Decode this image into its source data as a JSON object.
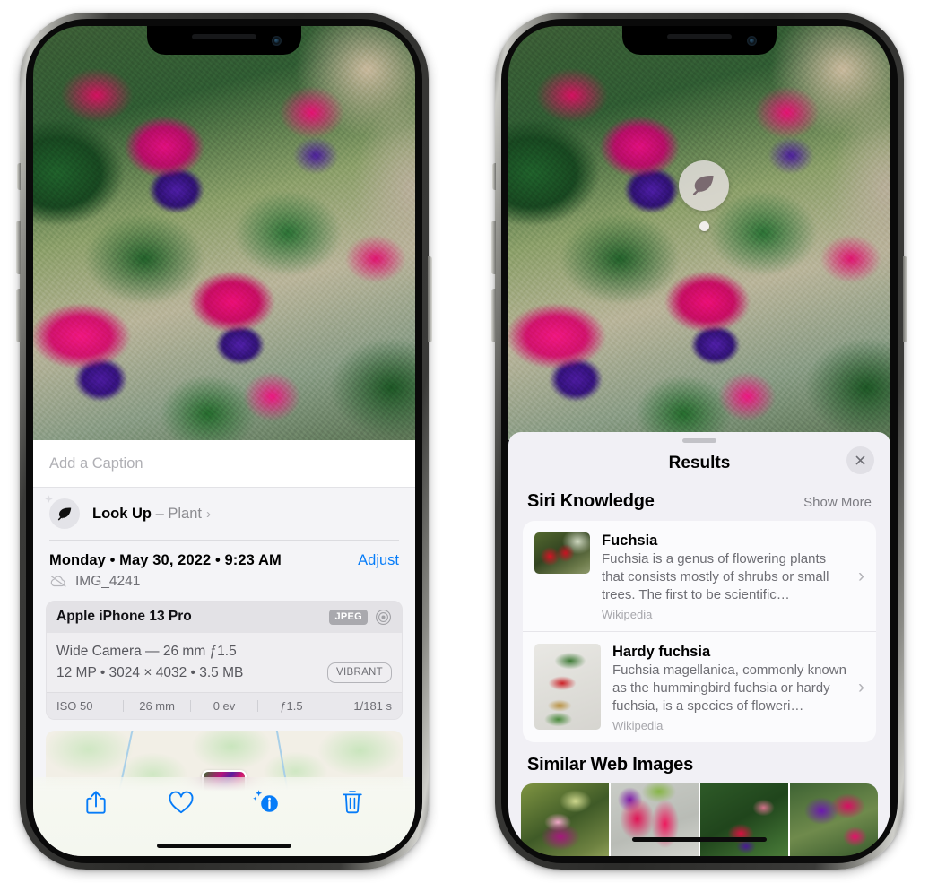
{
  "left_phone": {
    "photo": {
      "alt": "fuchsia-flowers-photo"
    },
    "caption": {
      "placeholder": "Add a Caption",
      "value": ""
    },
    "look_up": {
      "icon": "leaf-icon",
      "label": "Look Up",
      "dash": "–",
      "subject": "Plant",
      "chevron": "›"
    },
    "datetime": "Monday • May 30, 2022 • 9:23 AM",
    "adjust_label": "Adjust",
    "filename": "IMG_4241",
    "filename_icon": "cloud-slash-icon",
    "camera": {
      "device": "Apple iPhone 13 Pro",
      "format_badge": "JPEG",
      "aperture_icon": "aperture-icon",
      "lens_line": "Wide Camera — 26 mm ƒ1.5",
      "specs_line": "12 MP • 3024 × 4032 • 3.5 MB",
      "style_badge": "VIBRANT",
      "exif": [
        "ISO 50",
        "26 mm",
        "0 ev",
        "ƒ1.5",
        "1/181 s"
      ]
    },
    "map": {
      "pin": "photo-thumbnail-pin"
    },
    "toolbar": [
      {
        "name": "share-icon",
        "label": "Share"
      },
      {
        "name": "heart-icon",
        "label": "Favorite"
      },
      {
        "name": "info-sparkle-icon",
        "label": "Info"
      },
      {
        "name": "trash-icon",
        "label": "Delete"
      }
    ]
  },
  "right_phone": {
    "badge": {
      "icon": "leaf-icon",
      "label": "Visual Look Up"
    },
    "sheet": {
      "title": "Results",
      "close_icon": "close-icon",
      "grabber": "sheet-grabber"
    },
    "siri_knowledge": {
      "title": "Siri Knowledge",
      "show_more": "Show More",
      "items": [
        {
          "title": "Fuchsia",
          "description": "Fuchsia is a genus of flowering plants that consists mostly of shrubs or small trees. The first to be scientific…",
          "source": "Wikipedia",
          "chevron": "›"
        },
        {
          "title": "Hardy fuchsia",
          "description": "Fuchsia magellanica, commonly known as the hummingbird fuchsia or hardy fuchsia, is a species of floweri…",
          "source": "Wikipedia",
          "chevron": "›"
        }
      ]
    },
    "similar_web_images": {
      "title": "Similar Web Images",
      "thumbs": [
        "fuchsia-pink-white-bloom",
        "fuchsia-red-closeup",
        "fuchsia-shrub-buds",
        "fuchsia-purple-magenta"
      ]
    }
  },
  "colors": {
    "accent_blue": "#067CF8",
    "sheet_bg": "#F1F0F5",
    "card_bg": "#FBFBFD",
    "secondary_text": "#6E6E74"
  }
}
